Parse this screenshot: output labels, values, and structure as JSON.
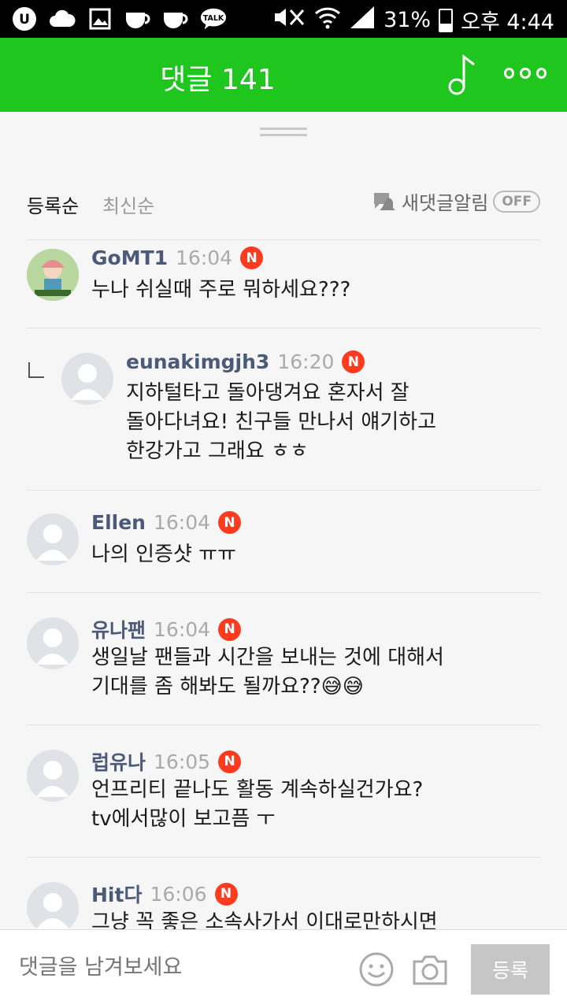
{
  "status_bar": {
    "battery_percent": "31%",
    "time": "오후 4:44",
    "talk_label": "TALK",
    "battery_level": 0.31
  },
  "header": {
    "title": "댓글 141"
  },
  "sort": {
    "options": [
      "등록순",
      "최신순"
    ],
    "active_index": 0,
    "notification_label": "새댓글알림",
    "toggle_state": "OFF"
  },
  "comments": [
    {
      "author": "GoMT1",
      "time": "16:04",
      "badge": "N",
      "text": "누나 쉬실때 주로 뭐하세요???",
      "is_reply": false,
      "avatar_text": "Playstore"
    },
    {
      "author": "eunakimgjh3",
      "time": "16:20",
      "badge": "N",
      "text": "지하털타고 돌아댕겨요 혼자서 잘\n돌아다녀요! 친구들 만나서 얘기하고\n한강가고 그래요 ㅎㅎ",
      "is_reply": true
    },
    {
      "author": "Ellen",
      "time": "16:04",
      "badge": "N",
      "text": "나의 인증샷 ㅠㅠ",
      "is_reply": false
    },
    {
      "author": "유나팬",
      "time": "16:04",
      "badge": "N",
      "text": "생일날 팬들과 시간을 보내는 것에 대해서\n기대를 좀 해봐도 될까요??😅😅",
      "is_reply": false
    },
    {
      "author": "럽유나",
      "time": "16:05",
      "badge": "N",
      "text": "언프리티 끝나도 활동 계속하실건가요?\ntv에서많이 보고픔 ㅜ",
      "is_reply": false
    },
    {
      "author": "Hit다",
      "time": "16:06",
      "badge": "N",
      "text": "그냥 꼭 좋은 소속사가서 이대로만하시면",
      "is_reply": false
    }
  ],
  "input": {
    "placeholder": "댓글을 남겨보세요",
    "submit_label": "등록"
  },
  "colors": {
    "header_green": "#1ec61e",
    "badge_red": "#ff3b1f",
    "author_blue": "#4a5a78"
  }
}
